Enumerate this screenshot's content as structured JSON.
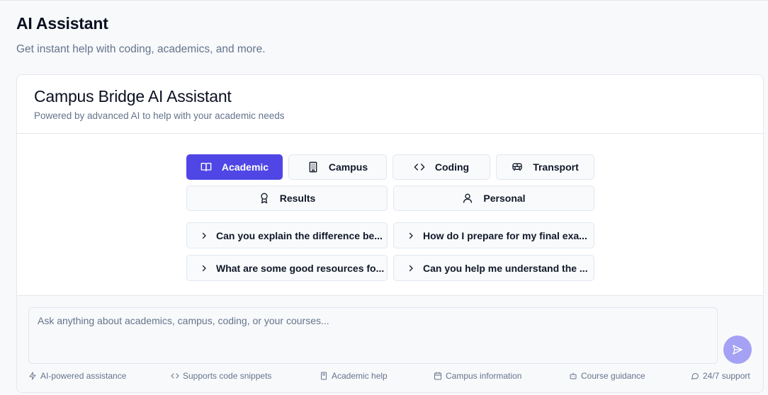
{
  "header": {
    "title": "AI Assistant",
    "subtitle": "Get instant help with coding, academics, and more."
  },
  "card": {
    "title": "Campus Bridge AI Assistant",
    "subtitle": "Powered by advanced AI to help with your academic needs"
  },
  "categories": [
    {
      "label": "Academic",
      "icon": "book-icon",
      "active": true
    },
    {
      "label": "Campus",
      "icon": "building-icon",
      "active": false
    },
    {
      "label": "Coding",
      "icon": "code-icon",
      "active": false
    },
    {
      "label": "Transport",
      "icon": "bus-icon",
      "active": false
    },
    {
      "label": "Results",
      "icon": "award-icon",
      "active": false
    },
    {
      "label": "Personal",
      "icon": "user-icon",
      "active": false
    }
  ],
  "suggestions": [
    {
      "text": "Can you explain the difference be..."
    },
    {
      "text": "How do I prepare for my final exa..."
    },
    {
      "text": "What are some good resources fo..."
    },
    {
      "text": "Can you help me understand the ..."
    }
  ],
  "input": {
    "placeholder": "Ask anything about academics, campus, coding, or your courses..."
  },
  "send": {
    "icon": "send-icon"
  },
  "features": [
    {
      "label": "AI-powered assistance",
      "icon": "zap-icon"
    },
    {
      "label": "Supports code snippets",
      "icon": "code-icon"
    },
    {
      "label": "Academic help",
      "icon": "book-icon"
    },
    {
      "label": "Campus information",
      "icon": "calendar-icon"
    },
    {
      "label": "Course guidance",
      "icon": "bot-icon"
    },
    {
      "label": "24/7 support",
      "icon": "message-icon"
    }
  ],
  "colors": {
    "accent": "#4f46e5",
    "send_disabled": "#a5a1f5",
    "muted_text": "#64748b"
  }
}
